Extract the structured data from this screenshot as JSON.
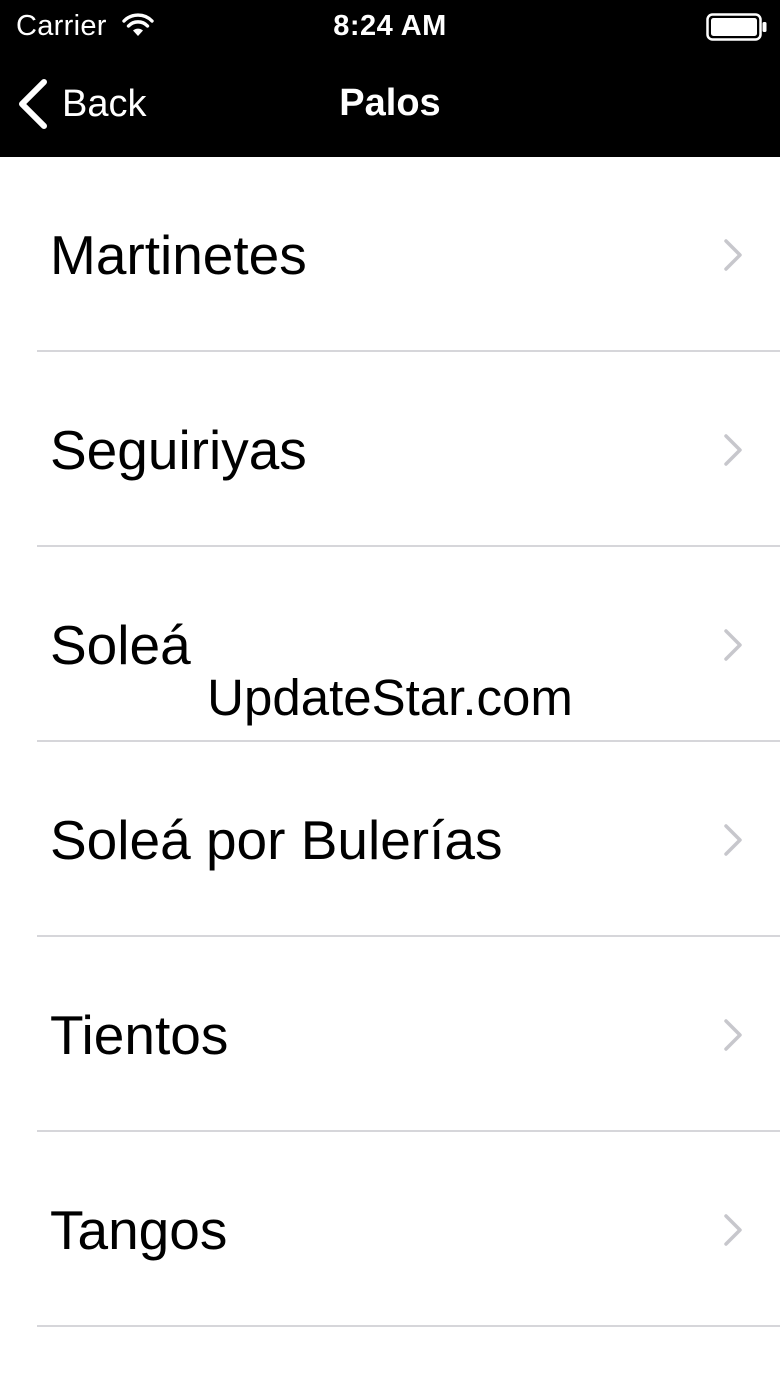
{
  "status_bar": {
    "carrier": "Carrier",
    "time": "8:24 AM",
    "wifi_icon": "wifi-icon",
    "battery_icon": "battery-icon"
  },
  "nav_bar": {
    "back_label": "Back",
    "back_icon": "chevron-left-icon",
    "title": "Palos",
    "background": "#000000"
  },
  "list": {
    "items": [
      {
        "label": "Martinetes"
      },
      {
        "label": "Seguiriyas"
      },
      {
        "label": "Soleá"
      },
      {
        "label": "Soleá por Bulerías"
      },
      {
        "label": "Tientos"
      },
      {
        "label": "Tangos"
      }
    ],
    "disclosure_icon": "chevron-right-icon",
    "separator_color": "#d6d6da",
    "chevron_color": "#c7c7cc"
  },
  "watermark": {
    "text": "UpdateStar.com"
  }
}
